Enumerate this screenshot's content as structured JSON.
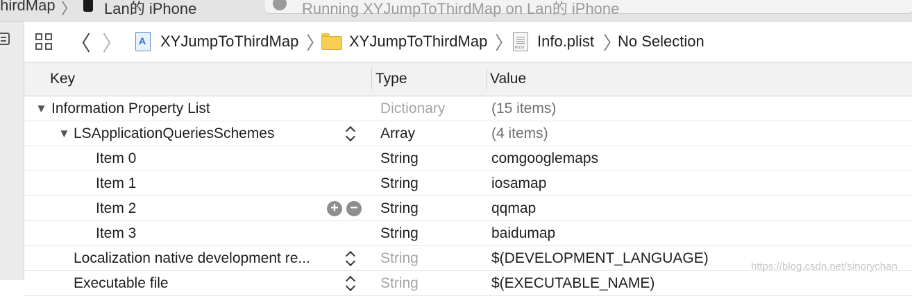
{
  "tabs": [
    {
      "label": "thirdMap",
      "device": "Lan的 iPhone"
    },
    {
      "label": "Running XYJumpToThirdMap on Lan的 iPhone"
    }
  ],
  "jumpbar": {
    "crumbs": [
      {
        "label": "XYJumpToThirdMap",
        "icon": "project-icon"
      },
      {
        "label": "XYJumpToThirdMap",
        "icon": "folder-icon"
      },
      {
        "label": "Info.plist",
        "icon": "plist-file-icon"
      },
      {
        "label": "No Selection"
      }
    ]
  },
  "table": {
    "headers": {
      "key": "Key",
      "type": "Type",
      "value": "Value"
    },
    "rows": [
      {
        "key": "Information Property List",
        "type": "Dictionary",
        "value": "(15 items)"
      },
      {
        "key": "LSApplicationQueriesSchemes",
        "type": "Array",
        "value": "(4 items)"
      },
      {
        "key": "Item 0",
        "type": "String",
        "value": "comgooglemaps"
      },
      {
        "key": "Item 1",
        "type": "String",
        "value": "iosamap"
      },
      {
        "key": "Item 2",
        "type": "String",
        "value": "qqmap"
      },
      {
        "key": "Item 3",
        "type": "String",
        "value": "baidumap"
      },
      {
        "key": "Localization native development re...",
        "type": "String",
        "value": "$(DEVELOPMENT_LANGUAGE)"
      },
      {
        "key": "Executable file",
        "type": "String",
        "value": "$(EXECUTABLE_NAME)"
      }
    ]
  },
  "watermark": "https://blog.csdn.net/sinorychan"
}
